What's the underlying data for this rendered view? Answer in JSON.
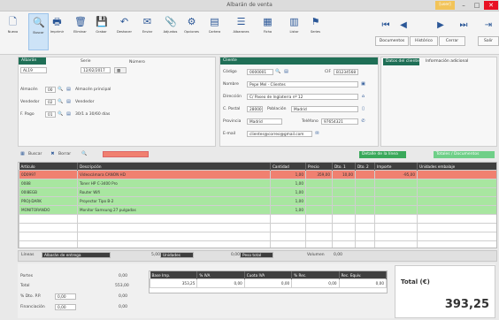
{
  "window": {
    "title": "Albarán de venta",
    "user_label": "[user]",
    "minimize": "–",
    "maximize": "□",
    "close": "✕"
  },
  "ribbon": {
    "buttons": [
      {
        "label": "Nuevo",
        "icon": "new-doc-icon",
        "glyph": "🗋"
      },
      {
        "label": "Buscar",
        "icon": "search-doc-icon",
        "glyph": "🔍"
      },
      {
        "label": "Imprimir",
        "icon": "print-icon",
        "glyph": "🖶"
      },
      {
        "label": "Eliminar",
        "icon": "delete-icon",
        "glyph": "🗑"
      },
      {
        "label": "Grabar",
        "icon": "save-icon",
        "glyph": "💾"
      },
      {
        "label": "Deshacer",
        "icon": "undo-icon",
        "glyph": "↶"
      },
      {
        "label": "Enviar",
        "icon": "send-icon",
        "glyph": "✉"
      },
      {
        "label": "Adjuntos",
        "icon": "attach-icon",
        "glyph": "📎"
      },
      {
        "label": "Opciones",
        "icon": "gear-icon",
        "glyph": "⚙"
      },
      {
        "label": "Cartera",
        "icon": "wallet-icon",
        "glyph": "▤"
      },
      {
        "label": "Albaranes",
        "icon": "list-icon",
        "glyph": "☰"
      },
      {
        "label": "Ficha",
        "icon": "card-icon",
        "glyph": "▦"
      },
      {
        "label": "Listar",
        "icon": "table-icon",
        "glyph": "▥"
      },
      {
        "label": "Series",
        "icon": "filter-icon",
        "glyph": "⚑"
      }
    ],
    "nav": {
      "first": "⏮",
      "prev": "◀",
      "next": "▶",
      "last": "⏭",
      "exit": "⇥",
      "documentos": "Documentos",
      "historico": "Histórico",
      "cerrar": "Cerrar",
      "salir": "Salir"
    }
  },
  "doc": {
    "header": "Albarán",
    "serie_label": "Serie",
    "serie_value": "AL19",
    "numero_label": "Número",
    "fecha_value": "12/02/2017",
    "almacen_label": "Almacén",
    "almacen_code": "00",
    "almacen_value": "Almacén principal",
    "vendedor_label": "Vendedor",
    "vendedor_code": "02",
    "vendedor_value": "Vendedor",
    "fpago_label": "F. Pago",
    "fpago_code": "01",
    "fpago_value": "30/1 a 30/60 días"
  },
  "client": {
    "header": "Cliente",
    "codigo_label": "Código",
    "codigo_value": "0000001",
    "cif_label": "CIF",
    "cif_value": "B1234568",
    "nombre_label": "Nombre",
    "nombre_value": "Pepe Mel · Clientes",
    "direccion_label": "Dirección",
    "direccion_value": "C/ Paseo de Inglaterra nº 12",
    "cpostal_label": "C. Postal",
    "cpostal_value": "28000",
    "poblacion_label": "Población",
    "poblacion_value": "Madrid",
    "provincia_label": "Provincia",
    "provincia_value": "Madrid",
    "telefono_label": "Teléfono",
    "telefono_value": "97654321",
    "email_label": "E-mail",
    "email_value": "clientes@correo@gmail.com"
  },
  "tabs_top": {
    "tab1": "Datos del cliente",
    "tab2": "Información adicional"
  },
  "lines_toolbar": {
    "buscar": "Buscar",
    "borrar": "Borrar",
    "search_placeholder": "Buscar artículo",
    "right_tab1": "Detalle de la línea",
    "right_tab2": "Totales / Documentos"
  },
  "grid": {
    "headers": [
      "Artículo",
      "Descripción",
      "Cantidad",
      "Precio",
      "Dto. 1",
      "Dto. 2",
      "Importe",
      "Unidades embalaje"
    ],
    "rows": [
      {
        "cls": "red",
        "cells": [
          "0D0997",
          "Videocámara CANON HD",
          "1,00",
          "359,00",
          "10,00",
          "",
          "-95,00",
          ""
        ]
      },
      {
        "cls": "green",
        "cells": [
          "0088",
          "Toner HP C-3400 Pro",
          "1,00",
          "",
          "",
          "",
          "",
          ""
        ]
      },
      {
        "cls": "green",
        "cells": [
          "00I8EGB",
          "Router Wifi",
          "1,00",
          "",
          "",
          "",
          "",
          ""
        ]
      },
      {
        "cls": "green",
        "cells": [
          "PROJ-DARK",
          "Proyector Tipo B-2",
          "1,00",
          "",
          "",
          "",
          "",
          ""
        ]
      },
      {
        "cls": "green",
        "cells": [
          "MONITORANDO",
          "Monitor Samsung 27 pulgadas",
          "1,00",
          "",
          "",
          "",
          "",
          ""
        ]
      },
      {
        "cls": "empty",
        "cells": [
          "",
          "",
          "",
          "",
          "",
          "",
          "",
          ""
        ]
      },
      {
        "cls": "empty",
        "cells": [
          "",
          "",
          "",
          "",
          "",
          "",
          "",
          ""
        ]
      },
      {
        "cls": "empty",
        "cells": [
          "",
          "",
          "",
          "",
          "",
          "",
          "",
          ""
        ]
      },
      {
        "cls": "empty",
        "cells": [
          "",
          "",
          "",
          "",
          "",
          "",
          "",
          ""
        ]
      }
    ]
  },
  "statusbar": {
    "lineas_label": "Líneas",
    "mensaje": "Albarán de entrega",
    "campo1": "Unidades",
    "campo1_val": "5,00",
    "campo2": "Peso total",
    "campo2_val": "0,00",
    "campo3": "Volumen",
    "campo3_val": "0,00",
    "campo4": "Bultos",
    "campo4_val": "0,00"
  },
  "totals_left": {
    "portes_label": "Portes",
    "portes_value": "0,00",
    "total_label": "Total",
    "total_value": "553,00",
    "dto_label": "% Dto. P.P.",
    "dto_pct": "0,00",
    "dto_value": "0,00",
    "financ_label": "Financiación",
    "financ_pct": "0,00",
    "financ_value": "0,00"
  },
  "tax_table": {
    "headers": [
      "Base Imp.",
      "% IVA",
      "Cuota IVA",
      "% Rec.",
      "Rec. Equiv."
    ],
    "values": [
      "353,25",
      "0,00",
      "0,00",
      "0,00",
      "0,00"
    ]
  },
  "grand_total": {
    "label": "Total (€)",
    "value": "393,25"
  }
}
